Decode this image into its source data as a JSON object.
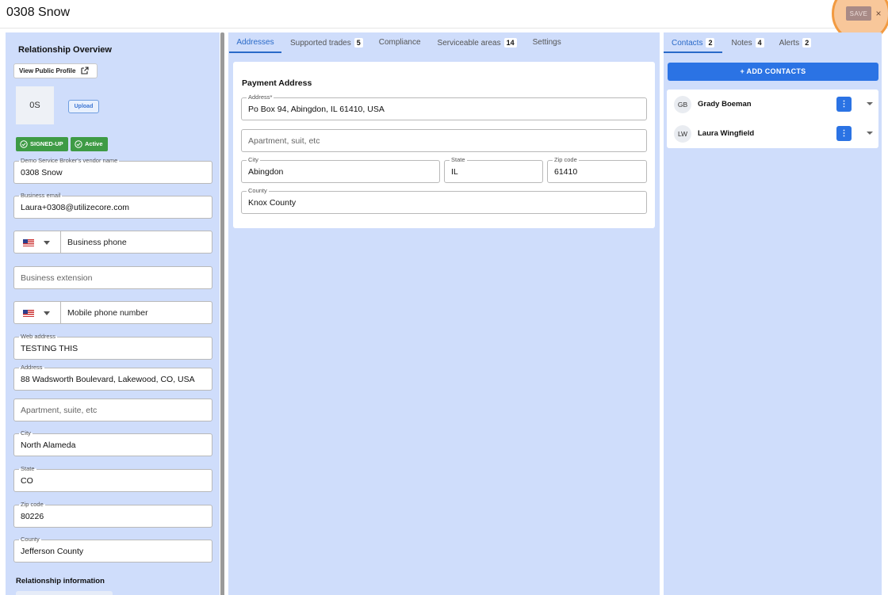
{
  "header": {
    "title": "0308 Snow",
    "save_label": "SAVE",
    "close_glyph": "×"
  },
  "left": {
    "title": "Relationship Overview",
    "view_profile_label": "View Public Profile",
    "avatar_initials": "0S",
    "upload_label": "Upload",
    "badges": [
      {
        "label": "SIGNED-UP"
      },
      {
        "label": "Active"
      }
    ],
    "vendor_name": {
      "label": "Demo Service Broker's vendor name",
      "value": "0308 Snow"
    },
    "business_email": {
      "label": "Business email",
      "value": "Laura+0308@utilizecore.com"
    },
    "business_phone": {
      "placeholder": "Business phone"
    },
    "business_extension": {
      "placeholder": "Business extension"
    },
    "mobile_phone": {
      "placeholder": "Mobile phone number"
    },
    "web_address": {
      "label": "Web address",
      "value": "TESTING THIS"
    },
    "address": {
      "label": "Address",
      "value": "88 Wadsworth Boulevard, Lakewood, CO, USA"
    },
    "apartment": {
      "placeholder": "Apartment, suite, etc"
    },
    "city": {
      "label": "City",
      "value": "North Alameda"
    },
    "state": {
      "label": "State",
      "value": "CO"
    },
    "zip": {
      "label": "Zip code",
      "value": "80226"
    },
    "county": {
      "label": "County",
      "value": "Jefferson County"
    },
    "relationship_info_title": "Relationship information"
  },
  "middle": {
    "tabs": [
      {
        "label": "Addresses",
        "count": ""
      },
      {
        "label": "Supported trades",
        "count": "5"
      },
      {
        "label": "Compliance",
        "count": ""
      },
      {
        "label": "Serviceable areas",
        "count": "14"
      },
      {
        "label": "Settings",
        "count": ""
      }
    ],
    "payment": {
      "title": "Payment Address",
      "address": {
        "label": "Address*",
        "value": "Po Box 94, Abingdon, IL 61410, USA"
      },
      "apartment": {
        "placeholder": "Apartment, suit, etc"
      },
      "city": {
        "label": "City",
        "value": "Abingdon"
      },
      "state": {
        "label": "State",
        "value": "IL"
      },
      "zip": {
        "label": "Zip code",
        "value": "61410"
      },
      "county": {
        "label": "County",
        "value": "Knox County"
      }
    }
  },
  "right": {
    "tabs": [
      {
        "label": "Contacts",
        "count": "2"
      },
      {
        "label": "Notes",
        "count": "4"
      },
      {
        "label": "Alerts",
        "count": "2"
      }
    ],
    "add_label": "+ ADD CONTACTS",
    "contacts": [
      {
        "initials": "GB",
        "name": "Grady Boeman"
      },
      {
        "initials": "LW",
        "name": "Laura Wingfield"
      }
    ]
  },
  "colors": {
    "panel_bg": "#cfddfb",
    "primary": "#2b73e4",
    "success": "#3e9b45",
    "highlight": "#f29a40"
  },
  "icons": {
    "external_link": "external-link-icon",
    "check": "check-circle-icon",
    "kebab": "more-vert-icon",
    "dropdown": "chevron-down-icon"
  }
}
